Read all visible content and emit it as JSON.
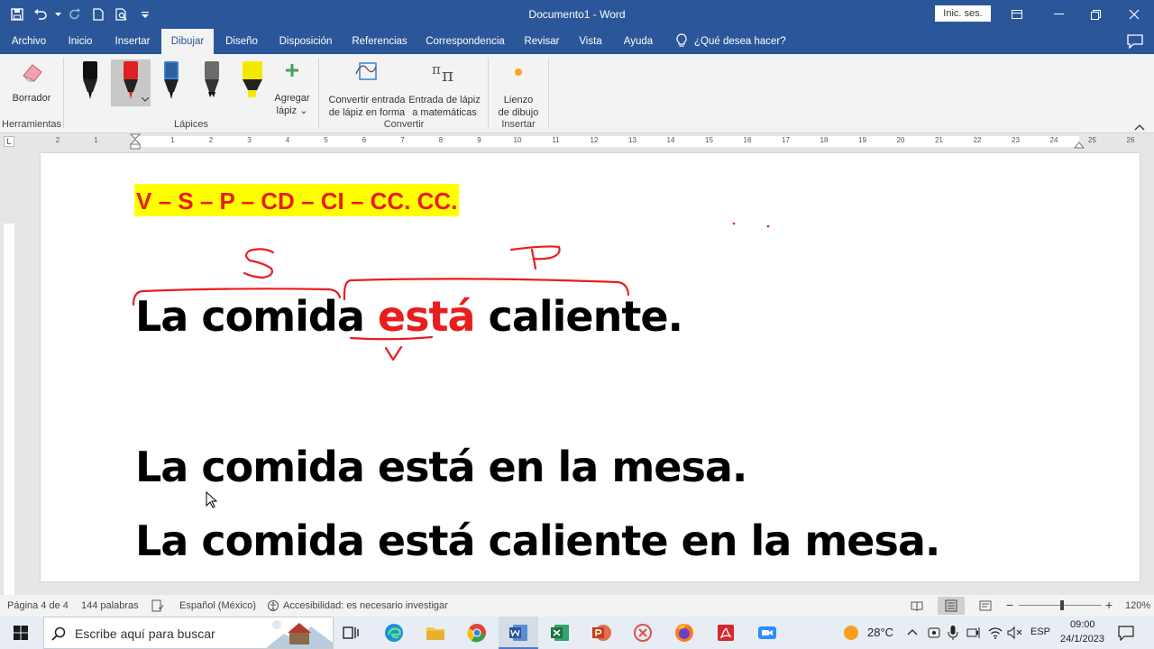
{
  "window": {
    "title": "Documento1  -  Word",
    "sign_in": "Inic. ses."
  },
  "tabs": [
    {
      "label": "Archivo"
    },
    {
      "label": "Inicio"
    },
    {
      "label": "Insertar"
    },
    {
      "label": "Dibujar"
    },
    {
      "label": "Diseño"
    },
    {
      "label": "Disposición"
    },
    {
      "label": "Referencias"
    },
    {
      "label": "Correspondencia"
    },
    {
      "label": "Revisar"
    },
    {
      "label": "Vista"
    },
    {
      "label": "Ayuda"
    }
  ],
  "active_tab": "Dibujar",
  "tell_me": "¿Qué desea hacer?",
  "ribbon": {
    "eraser": "Borrador",
    "add_pen_line1": "Agregar",
    "add_pen_line2": "lápiz",
    "convert_shape_line1": "Convertir entrada",
    "convert_shape_line2": "de lápiz en forma",
    "ink_math_line1": "Entrada de lápiz",
    "ink_math_line2": "a matemáticas",
    "canvas_line1": "Lienzo",
    "canvas_line2": "de dibujo",
    "groups": {
      "tools": "Herramientas",
      "pens": "Lápices",
      "convert": "Convertir",
      "insert": "Insertar"
    },
    "pen_colors": [
      "#111111",
      "#e02020",
      "#1a1a1a",
      "#6b6b6b",
      "#f5e800"
    ]
  },
  "document": {
    "pattern": "V – S – P – CD – CI – CC. CC.",
    "sentence1_pre": "La comida ",
    "sentence1_verb": "está",
    "sentence1_post": " caliente.",
    "sentence2": "La comida está en la mesa.",
    "sentence3": "La comida está caliente en la mesa.",
    "ink_s": "S",
    "ink_p": "P",
    "ink_v": "V",
    "ink_color": "#e81e1e"
  },
  "status": {
    "page": "Página 4 de 4",
    "words": "144 palabras",
    "language": "Español (México)",
    "accessibility": "Accesibilidad: es necesario investigar",
    "zoom": "120%"
  },
  "taskbar": {
    "search_placeholder": "Escribe aquí para buscar",
    "weather": "28°C",
    "language": "ESP",
    "time": "09:00",
    "date": "24/1/2023"
  }
}
